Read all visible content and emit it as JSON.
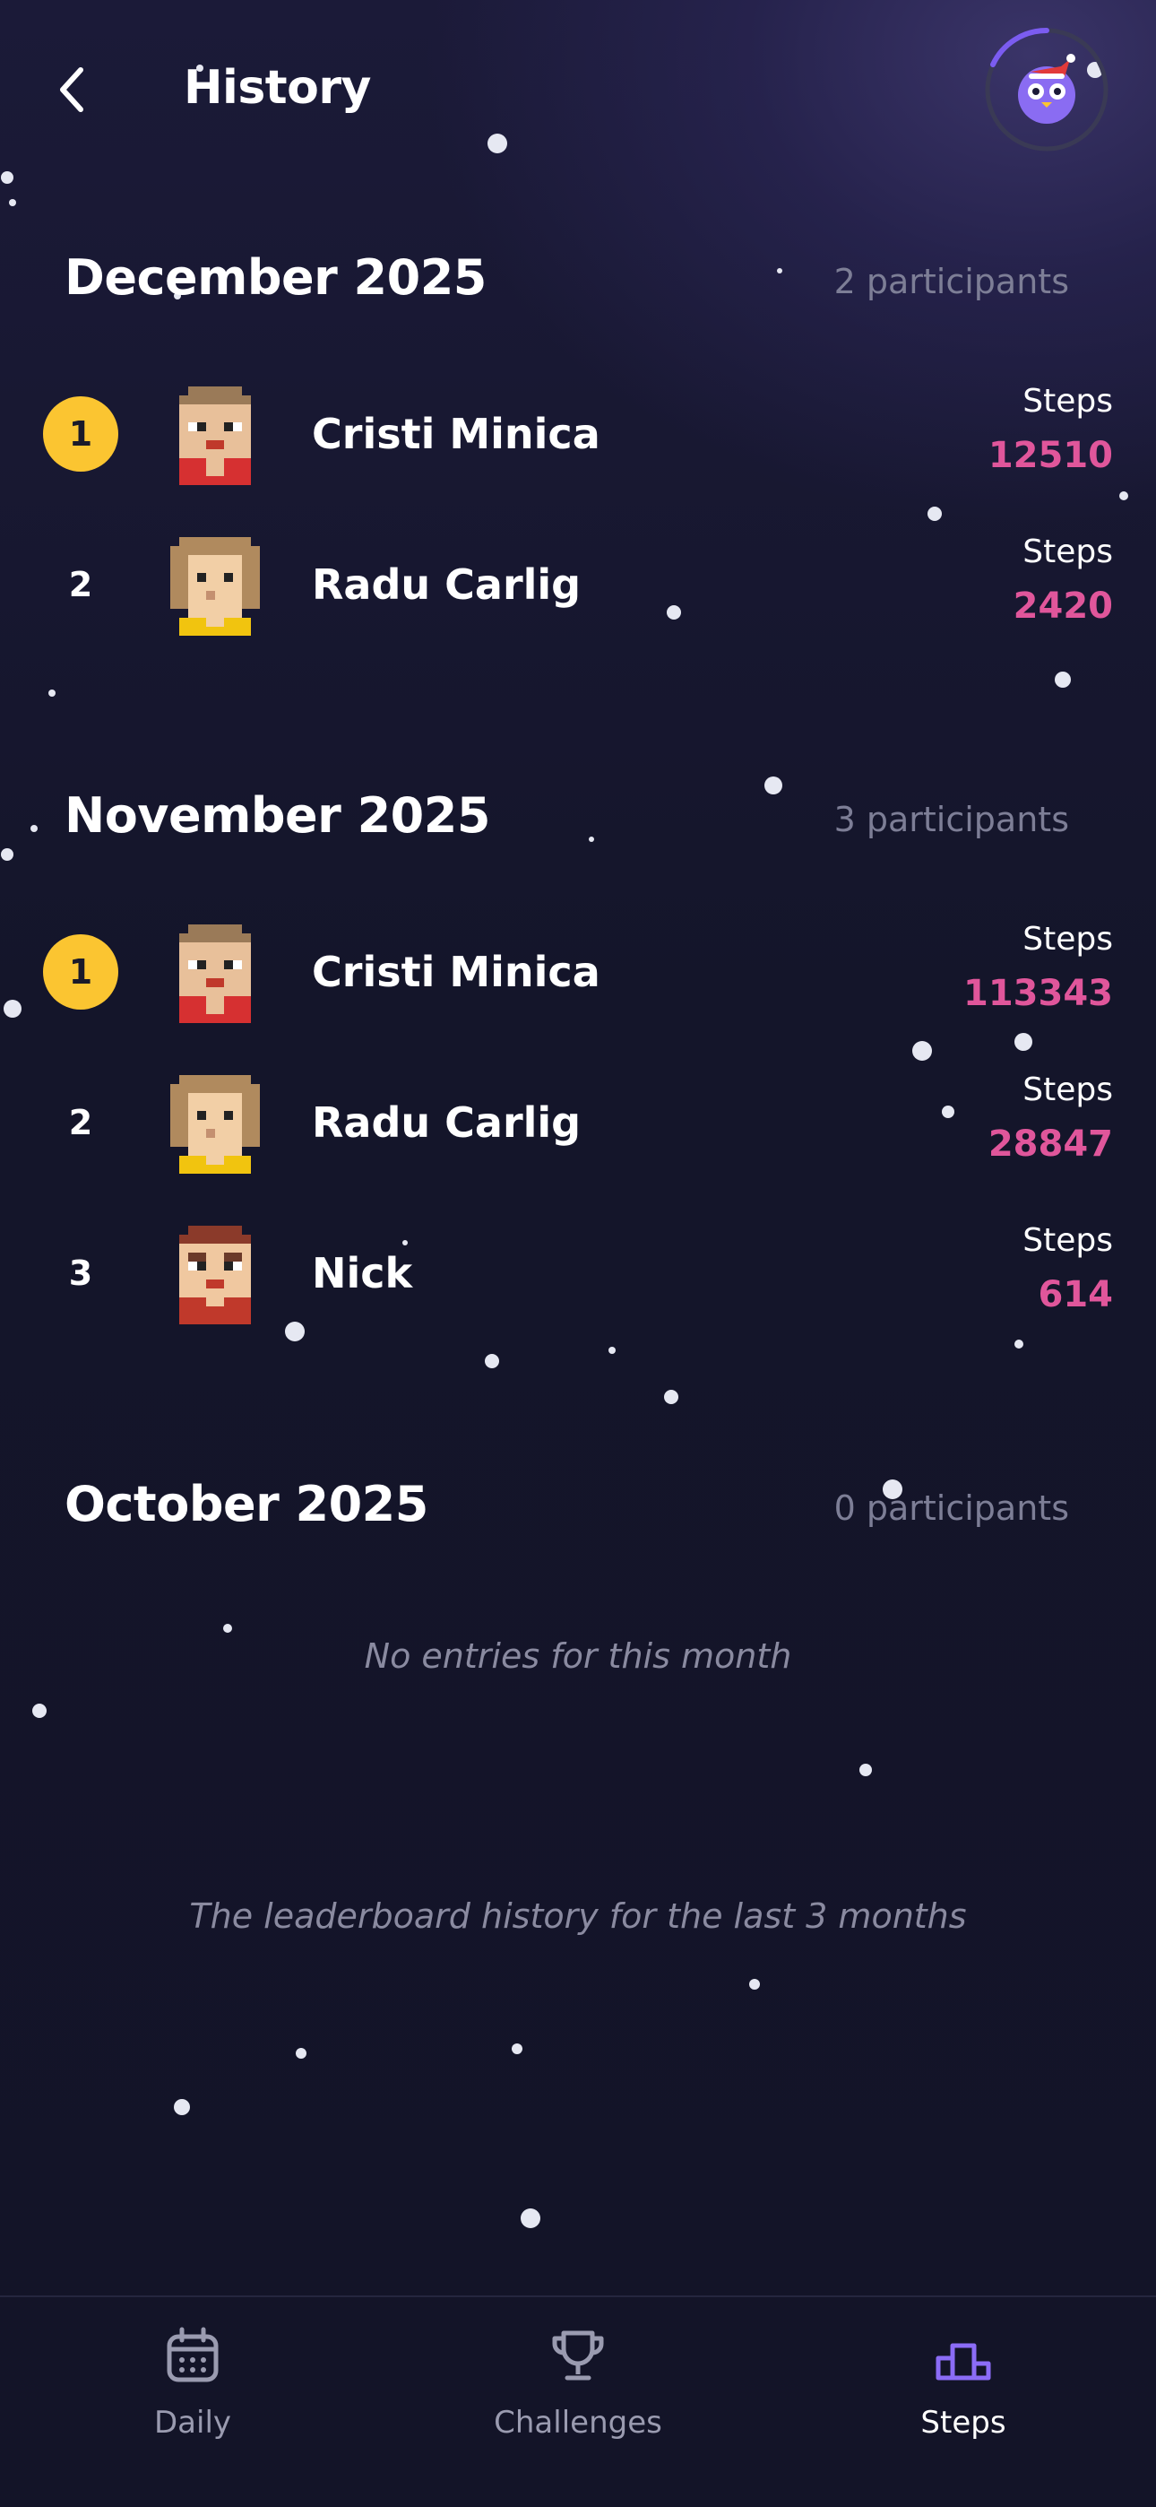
{
  "header": {
    "title": "History",
    "back_icon": "chevron-left-icon",
    "profile_icon": "owl-avatar-icon"
  },
  "sections": [
    {
      "month": "December 2025",
      "participants": "2 participants",
      "entries": [
        {
          "rank": "1",
          "name": "Cristi Minica",
          "steps_label": "Steps",
          "steps": "12510"
        },
        {
          "rank": "2",
          "name": "Radu Carlig",
          "steps_label": "Steps",
          "steps": "2420"
        }
      ]
    },
    {
      "month": "November 2025",
      "participants": "3 participants",
      "entries": [
        {
          "rank": "1",
          "name": "Cristi Minica",
          "steps_label": "Steps",
          "steps": "113343"
        },
        {
          "rank": "2",
          "name": "Radu Carlig",
          "steps_label": "Steps",
          "steps": "28847"
        },
        {
          "rank": "3",
          "name": "Nick",
          "steps_label": "Steps",
          "steps": "614"
        }
      ]
    },
    {
      "month": "October 2025",
      "participants": "0 participants",
      "empty": "No entries for this month"
    }
  ],
  "footer_note": "The leaderboard history for the last 3 months",
  "nav": {
    "daily": "Daily",
    "challenges": "Challenges",
    "steps": "Steps",
    "active": "steps"
  },
  "colors": {
    "accent_gold": "#fbc531",
    "steps_pink": "#e0569b",
    "nav_active": "#8b6cf6"
  }
}
